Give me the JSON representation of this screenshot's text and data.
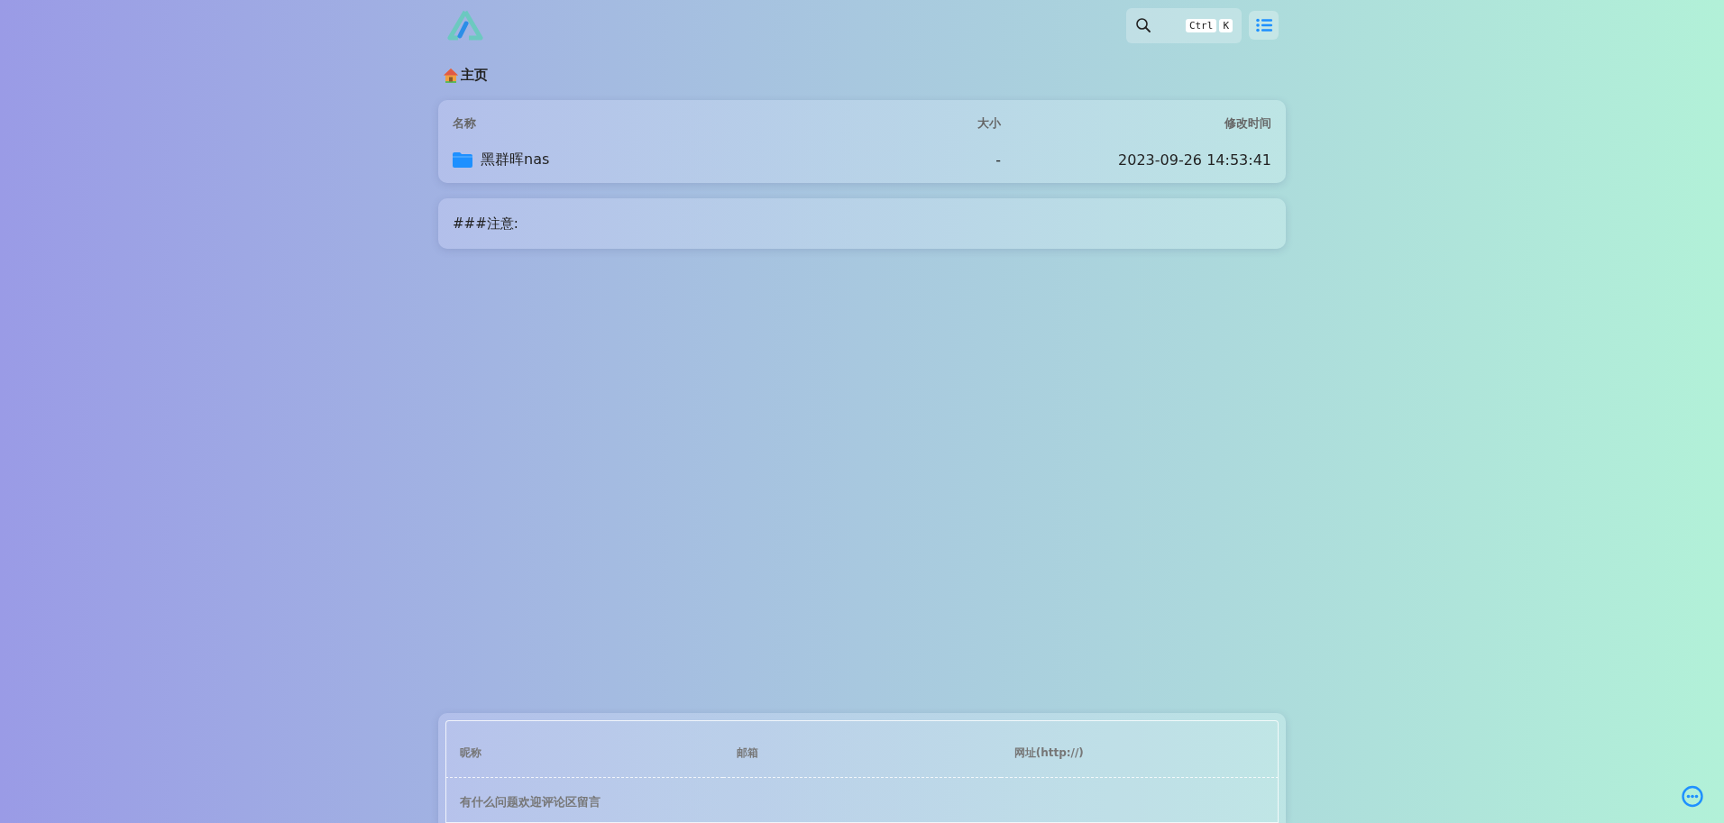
{
  "header": {
    "search": {
      "keys": [
        "Ctrl",
        "K"
      ]
    }
  },
  "breadcrumb": {
    "label": "主页"
  },
  "file_list": {
    "columns": [
      "名称",
      "大小",
      "修改时间"
    ],
    "rows": [
      {
        "kind": "folder",
        "name": "黑群晖nas",
        "size": "-",
        "modified": "2023-09-26 14:53:41"
      }
    ]
  },
  "notice": {
    "text": "###注意:"
  },
  "comment_form": {
    "fields": [
      {
        "placeholder": "昵称"
      },
      {
        "placeholder": "邮箱"
      },
      {
        "placeholder": "网址(http://)"
      }
    ],
    "textarea": {
      "placeholder": "有什么问题欢迎评论区留言"
    }
  }
}
